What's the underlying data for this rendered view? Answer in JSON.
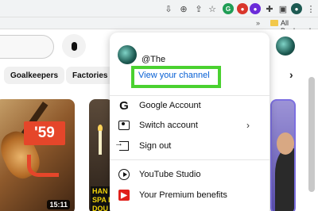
{
  "browser": {
    "bookmarks": {
      "overflow": "»",
      "label": "All Bookmarks"
    }
  },
  "chips": [
    "Goalkeepers",
    "Factories"
  ],
  "thumbnails": {
    "left": {
      "badge": "'59",
      "duration": "15:11"
    },
    "middle": {
      "text": "HAN SPA DIN DOU"
    }
  },
  "menu": {
    "handle": "@The",
    "view_channel": "View your channel",
    "items": [
      {
        "label": "Google Account",
        "icon": "google-icon"
      },
      {
        "label": "Switch account",
        "icon": "switch-account-icon",
        "chevron": "›"
      },
      {
        "label": "Sign out",
        "icon": "sign-out-icon"
      },
      {
        "label": "YouTube Studio",
        "icon": "studio-icon"
      },
      {
        "label": "Your Premium benefits",
        "icon": "premium-icon"
      }
    ]
  },
  "colors": {
    "highlight": "#4ad130",
    "link": "#065fd4",
    "premium": "#e0201b"
  }
}
